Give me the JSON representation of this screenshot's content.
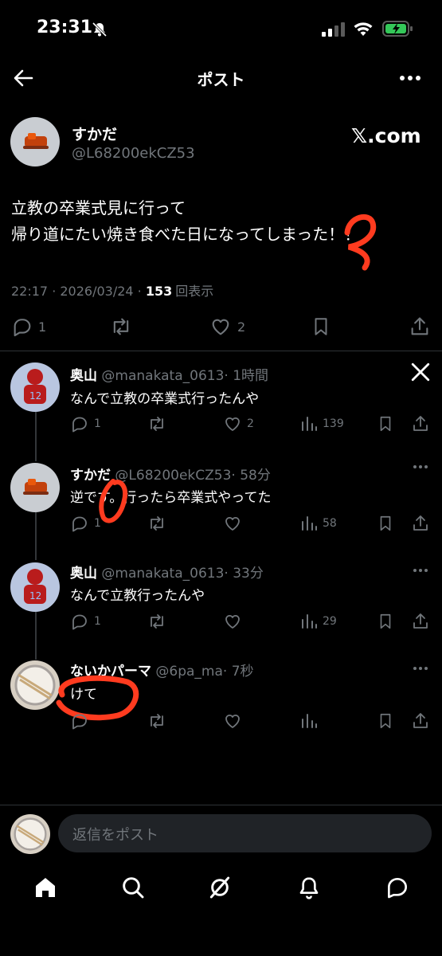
{
  "status_bar": {
    "time": "23:31"
  },
  "header": {
    "title": "ポスト"
  },
  "post": {
    "author_name": "すかだ",
    "author_handle": "@L68200ekCZ53",
    "source": "𝕏.com",
    "lines": [
      "立教の卒業式見に行って",
      "帰り道にたい焼き食べた日になってしまった！！"
    ],
    "timestamp": "22:17 · 2026/03/24 · ",
    "views_count": "153",
    "views_label": "回表示",
    "replies": "1",
    "likes": "2"
  },
  "replies": [
    {
      "name": "奥山",
      "handle": "@manakata_0613",
      "time": "· 1時間",
      "text": "なんで立教の卒業式行ったんや",
      "replies": "1",
      "likes": "2",
      "views": "139"
    },
    {
      "name": "すかだ",
      "handle": "@L68200ekCZ53",
      "time": "· 58分",
      "text": "逆です。行ったら卒業式やってた",
      "replies": "1",
      "likes": "",
      "views": "58"
    },
    {
      "name": "奥山",
      "handle": "@manakata_0613",
      "time": "· 33分",
      "text": "なんで立教行ったんや",
      "replies": "1",
      "likes": "",
      "views": "29"
    },
    {
      "name": "ないかパーマ",
      "handle": "@6pa_ma",
      "time": "· 7秒",
      "text": "けて",
      "replies": "",
      "likes": "",
      "views": ""
    }
  ],
  "compose": {
    "placeholder": "返信をポスト"
  },
  "colors": {
    "background": "#000000",
    "muted": "#71767b",
    "annotation": "#ff3b1f"
  }
}
